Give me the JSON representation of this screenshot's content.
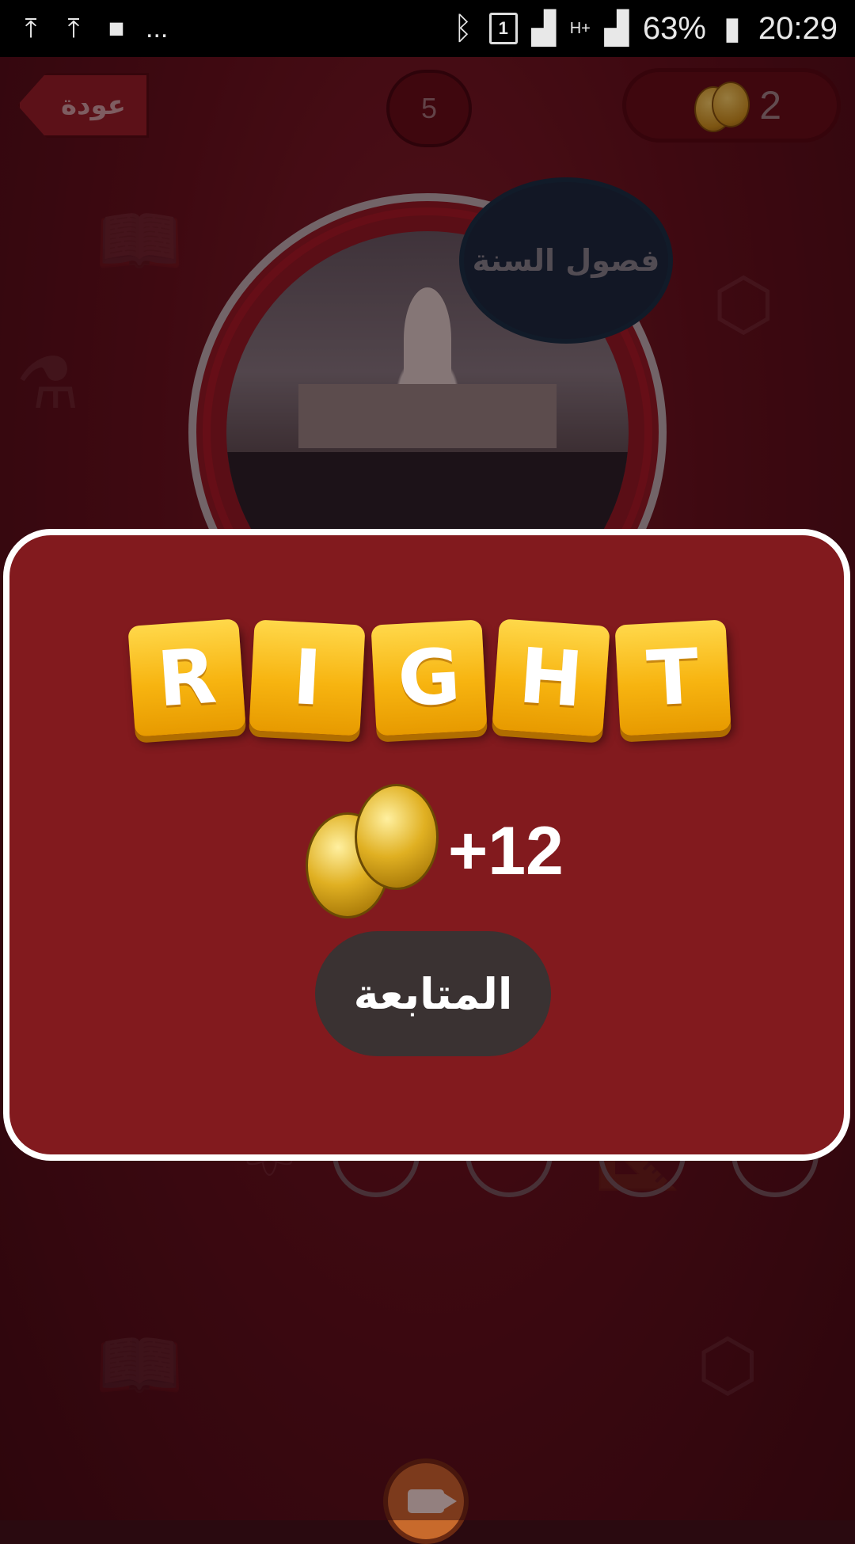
{
  "status_bar": {
    "left_icons": [
      "upload-icon",
      "upload-icon",
      "video-icon"
    ],
    "overflow": "...",
    "sim_slot": "1",
    "network_type": "H+",
    "battery": "63%",
    "time": "20:29"
  },
  "header": {
    "back_label": "عودة",
    "level": "5",
    "coins": "2"
  },
  "question": {
    "category": "فصول السنة"
  },
  "dialog": {
    "result_letters": [
      "R",
      "I",
      "G",
      "H",
      "T"
    ],
    "reward": "+12",
    "continue_label": "المتابعة"
  }
}
